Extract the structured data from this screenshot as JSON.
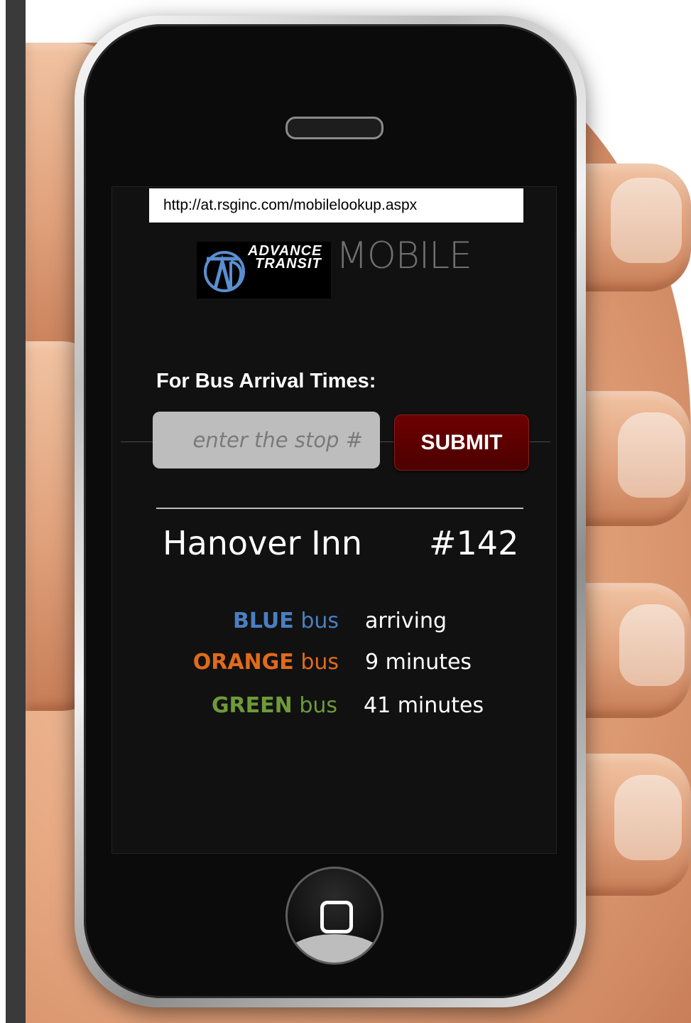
{
  "browser": {
    "url": "http://at.rsginc.com/mobilelookup.aspx"
  },
  "header": {
    "logo_line1": "ADVANCE",
    "logo_line2": "TRANSIT",
    "mobile_word": "MOBILE"
  },
  "form": {
    "label": "For Bus Arrival Times:",
    "stop_input_placeholder": "enter the stop #",
    "submit_label": "SUBMIT"
  },
  "result": {
    "stop_name": "Hanover Inn",
    "stop_number": "#142",
    "buses": [
      {
        "color_word": "BLUE",
        "bus_word": "bus",
        "time": "arriving",
        "color": "#4a7fc1"
      },
      {
        "color_word": "ORANGE",
        "bus_word": "bus",
        "time": "9 minutes",
        "color": "#e06b1b"
      },
      {
        "color_word": "GREEN",
        "bus_word": "bus",
        "time": "41 minutes",
        "color": "#6f9a3a"
      }
    ]
  },
  "colors": {
    "submit_bg": "#5a0000",
    "screen_bg": "#111111",
    "input_bg": "#bdbdbd"
  }
}
